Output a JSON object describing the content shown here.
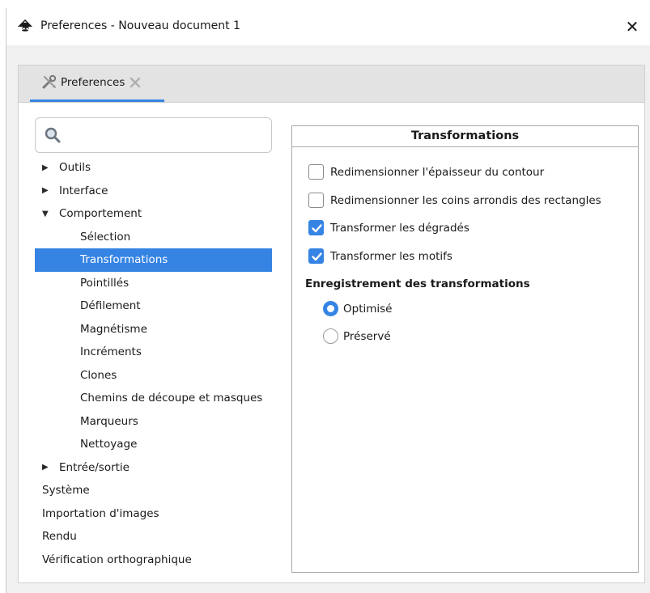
{
  "window": {
    "title": "Preferences - Nouveau document 1",
    "close_glyph": "✕"
  },
  "tab": {
    "label": "Preferences",
    "icon": "tools-icon",
    "close_icon": "close-tab-icon"
  },
  "search": {
    "value": "",
    "placeholder": ""
  },
  "tree": [
    {
      "label": "Outils",
      "level": 0,
      "expander": "collapsed"
    },
    {
      "label": "Interface",
      "level": 0,
      "expander": "collapsed"
    },
    {
      "label": "Comportement",
      "level": 0,
      "expander": "expanded"
    },
    {
      "label": "Sélection",
      "level": 1
    },
    {
      "label": "Transformations",
      "level": 1,
      "selected": true
    },
    {
      "label": "Pointillés",
      "level": 1
    },
    {
      "label": "Défilement",
      "level": 1
    },
    {
      "label": "Magnétisme",
      "level": 1
    },
    {
      "label": "Incréments",
      "level": 1
    },
    {
      "label": "Clones",
      "level": 1
    },
    {
      "label": "Chemins de découpe et masques",
      "level": 1
    },
    {
      "label": "Marqueurs",
      "level": 1
    },
    {
      "label": "Nettoyage",
      "level": 1
    },
    {
      "label": "Entrée/sortie",
      "level": 0,
      "expander": "collapsed"
    },
    {
      "label": "Système",
      "level": 0
    },
    {
      "label": "Importation d'images",
      "level": 0
    },
    {
      "label": "Rendu",
      "level": 0
    },
    {
      "label": "Vérification orthographique",
      "level": 0
    }
  ],
  "panel": {
    "title": "Transformations",
    "checkboxes": [
      {
        "label": "Redimensionner l'épaisseur du contour",
        "checked": false
      },
      {
        "label": "Redimensionner les coins arrondis des rectangles",
        "checked": false
      },
      {
        "label": "Transformer les dégradés",
        "checked": true
      },
      {
        "label": "Transformer les motifs",
        "checked": true
      }
    ],
    "section_title": "Enregistrement des transformations",
    "radios": [
      {
        "label": "Optimisé",
        "checked": true
      },
      {
        "label": "Préservé",
        "checked": false
      }
    ]
  },
  "colors": {
    "accent": "#3584e4",
    "window_bg": "#f0f0f0",
    "content_bg": "#ffffff"
  }
}
